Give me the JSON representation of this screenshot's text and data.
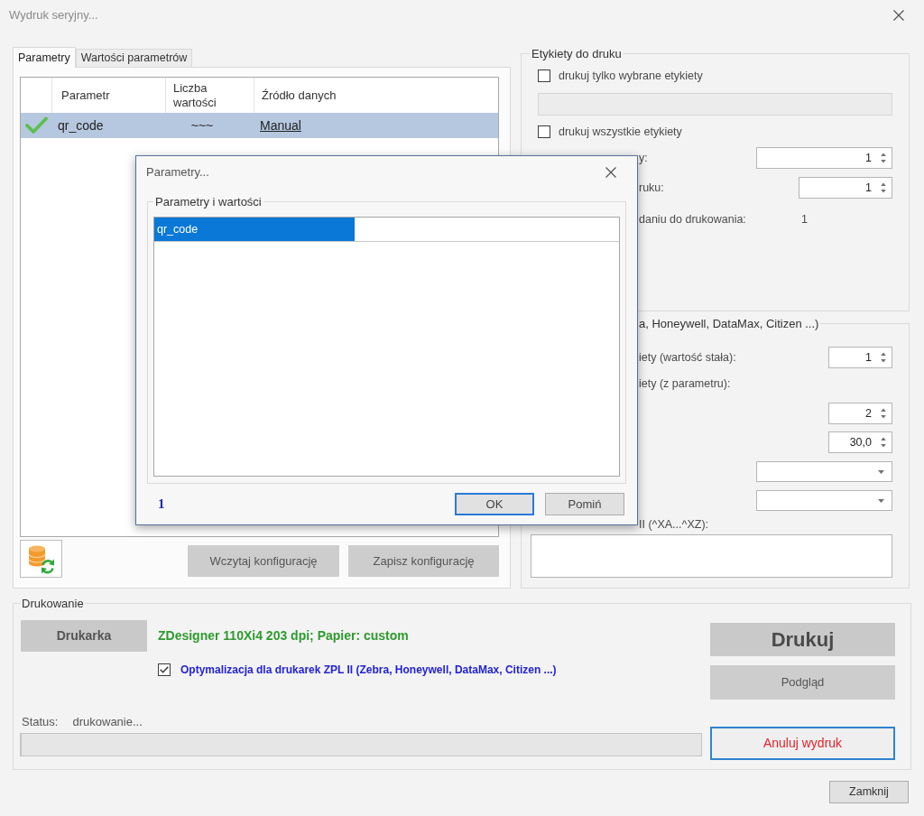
{
  "window": {
    "title": "Wydruk seryjny..."
  },
  "tabs": [
    {
      "label": "Parametry",
      "selected": true
    },
    {
      "label": "Wartości parametrów",
      "selected": false
    }
  ],
  "parameters_table": {
    "columns": [
      "Parametr",
      "Liczba wartości",
      "Źródło danych"
    ],
    "rows": [
      {
        "valid": true,
        "selected": true,
        "cells": [
          "qr_code",
          "~~~",
          "Manual"
        ]
      }
    ]
  },
  "config_buttons": [
    "Wczytaj konfigurację",
    "Zapisz konfigurację"
  ],
  "labels_group": {
    "title": "Etykiety do druku",
    "items": [
      {
        "kind": "checkbox",
        "label": "drukuj tylko wybrane etykiety",
        "checked": false
      },
      {
        "kind": "input",
        "disabled": true
      },
      {
        "kind": "checkbox",
        "label": "drukuj wszystkie etykiety",
        "checked": false
      },
      {
        "kind": "spinner",
        "label": "y:",
        "value": "1"
      },
      {
        "kind": "spinner",
        "label": "ruku:",
        "value": "1"
      },
      {
        "kind": "reading",
        "label": "daniu do drukowania:",
        "value": "1"
      }
    ]
  },
  "zpl_group": {
    "title": "a, Honeywell, DataMax, Citizen ...)",
    "items": [
      {
        "kind": "spinner",
        "label": "iety (wartość stała):",
        "value": "1"
      },
      {
        "kind": "caption",
        "label": "iety (z parametru):"
      },
      {
        "kind": "spinner",
        "value": "2"
      },
      {
        "kind": "spinner",
        "value": "30,0"
      },
      {
        "kind": "dropdown"
      },
      {
        "kind": "dropdown"
      },
      {
        "kind": "caption",
        "label": "II (^XA...^XZ):"
      },
      {
        "kind": "textarea"
      }
    ]
  },
  "printing": {
    "title": "Drukowanie",
    "printer_button": "Drukarka",
    "printer_info": "ZDesigner 110Xi4 203 dpi; Papier: custom",
    "zpl_optimization": {
      "label": "Optymalizacja dla drukarek ZPL II (Zebra, Honeywell, DataMax, Citizen ...)",
      "checked": true
    },
    "status_label": "Status:",
    "status": "drukowanie...",
    "progress": {
      "level": 0
    },
    "print_button": "Drukuj",
    "preview_button": "Podgląd",
    "cancel_button": "Anuluj wydruk"
  },
  "close_button": "Zamknij",
  "dialog": {
    "title": "Parametry...",
    "group_title": "Parametry i wartości",
    "rows": [
      {
        "name": "qr_code",
        "selected": true
      }
    ],
    "count": "1",
    "buttons": [
      {
        "label": "OK",
        "default": true
      },
      {
        "label": "Pomiń",
        "default": false
      }
    ]
  }
}
